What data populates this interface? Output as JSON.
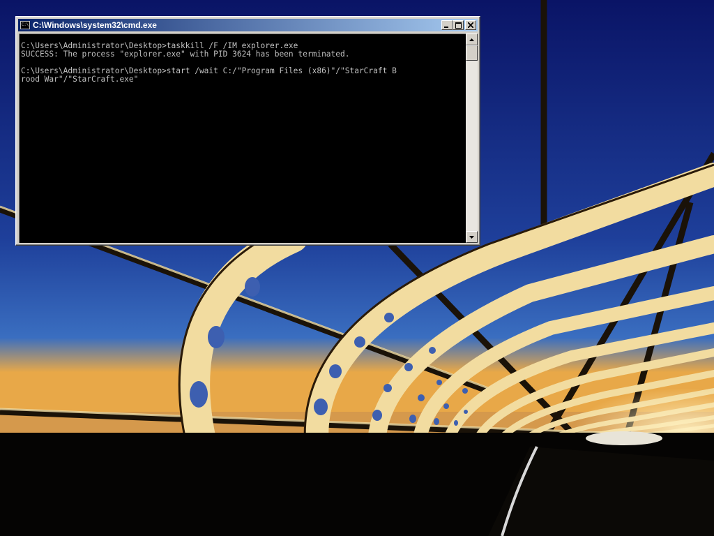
{
  "desktop": {
    "wallpaper": "bridge-tunnel-dusk",
    "colors": {
      "sky_top": "#0a1466",
      "sky_bottom": "#3a6ec0",
      "arch": "#f2dca0",
      "horizon": "#e8a848"
    }
  },
  "window": {
    "title": "C:\\Windows\\system32\\cmd.exe",
    "icon": "cmd-icon",
    "console_lines": [
      "C:\\Users\\Administrator\\Desktop>taskkill /F /IM explorer.exe",
      "SUCCESS: The process \"explorer.exe\" with PID 3624 has been terminated.",
      "",
      "C:\\Users\\Administrator\\Desktop>start /wait C:/\"Program Files (x86)\"/\"StarCraft B",
      "rood War\"/\"StarCraft.exe\""
    ],
    "colors": {
      "console_bg": "#000000",
      "console_text": "#c0c0c0",
      "title_bar": "#0a246a"
    }
  }
}
